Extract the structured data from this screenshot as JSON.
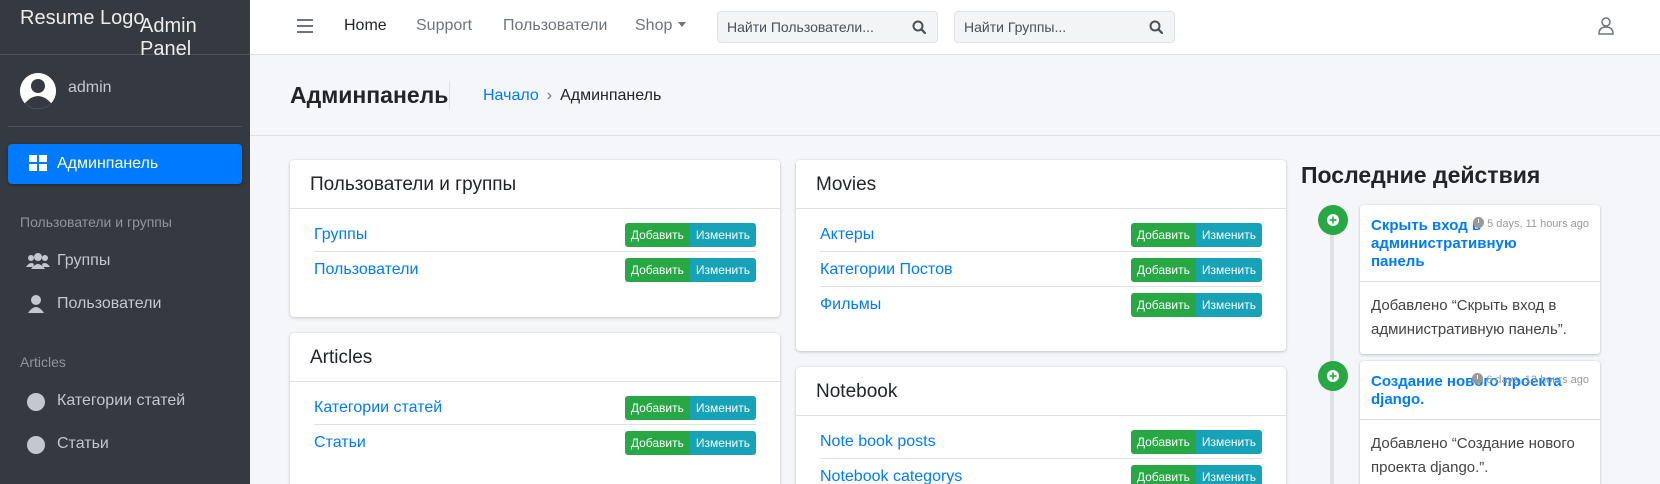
{
  "sidebar": {
    "brand_logo": "Resume Logo",
    "brand_panel": "Admin Panel",
    "username": "admin",
    "active_item": "Админпанель",
    "sections": [
      {
        "header": "Пользователи и группы",
        "items": [
          "Группы",
          "Пользователи"
        ]
      },
      {
        "header": "Articles",
        "items": [
          "Категории статей",
          "Статьи"
        ]
      }
    ]
  },
  "topbar": {
    "links": [
      "Home",
      "Support",
      "Пользователи",
      "Shop"
    ],
    "search_users_placeholder": "Найти Пользователи...",
    "search_groups_placeholder": "Найти Группы..."
  },
  "header": {
    "title": "Админпанель",
    "breadcrumb_home": "Начало",
    "breadcrumb_current": "Админпанель"
  },
  "buttons": {
    "add": "Добавить",
    "change": "Изменить"
  },
  "apps": [
    {
      "name": "Пользователи и группы",
      "models": [
        "Группы",
        "Пользователи"
      ]
    },
    {
      "name": "Articles",
      "models": [
        "Категории статей",
        "Статьи"
      ]
    },
    {
      "name": "Movies",
      "models": [
        "Актеры",
        "Категории Постов",
        "Фильмы"
      ]
    },
    {
      "name": "Notebook",
      "models": [
        "Note book posts",
        "Notebook categorys"
      ]
    }
  ],
  "recent": {
    "title": "Последние действия",
    "items": [
      {
        "title": "Скрыть вход в административную панель",
        "time": "5 days, 11 hours ago",
        "body": "Добавлено “Скрыть вход в административную панель”."
      },
      {
        "title": "Создание нового проекта django.",
        "time": "6 days, 13 hours ago",
        "body": "Добавлено “Создание нового проекта django.”."
      }
    ]
  },
  "colors": {
    "sidebar": "#343a40",
    "primary": "#007bff",
    "success": "#28a745",
    "info": "#17a2b8"
  }
}
